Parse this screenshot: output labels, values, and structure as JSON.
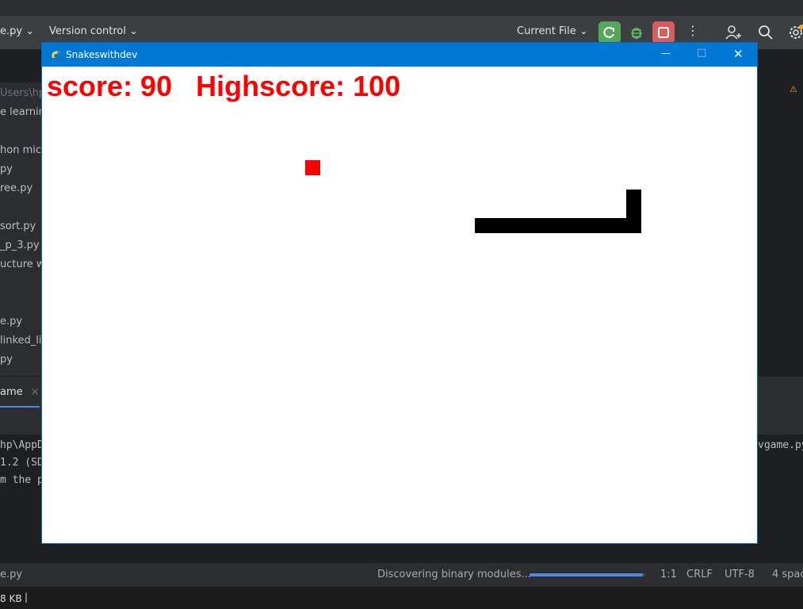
{
  "ide": {
    "toolbar": {
      "file_tab": "e.py",
      "version_control": "Version control",
      "run_config": "Current File"
    },
    "project_tree": [
      "Users\\hp",
      "e learning",
      "hon micr",
      "py",
      "ree.py",
      "sort.py",
      "_p_3.py",
      "ucture w",
      "e.py",
      "linked_lis",
      "py"
    ],
    "run_tab": "ame",
    "console_lines": [
      "hp\\AppD",
      "1.2 (SD",
      "m the p"
    ],
    "console_right": "vgame.py",
    "status": {
      "file": "e.py",
      "task": "Discovering binary modules...",
      "task_progress": 0.98,
      "position": "1:1",
      "line_sep": "CRLF",
      "encoding": "UTF-8",
      "indent": "4 spac"
    },
    "taskbar": {
      "memory": "8 KB"
    },
    "warn_indicator": "⚠"
  },
  "window": {
    "title": "Snakeswithdev",
    "minimize": "—",
    "maximize": "□",
    "close": "✕"
  },
  "game": {
    "score_label": "score: 90",
    "highscore_label": "Highscore: 100",
    "score": 90,
    "highscore": 100,
    "text_color": "#ff0000",
    "food_color": "#ff0000",
    "snake_color": "#000000",
    "background_color": "#ffffff"
  }
}
